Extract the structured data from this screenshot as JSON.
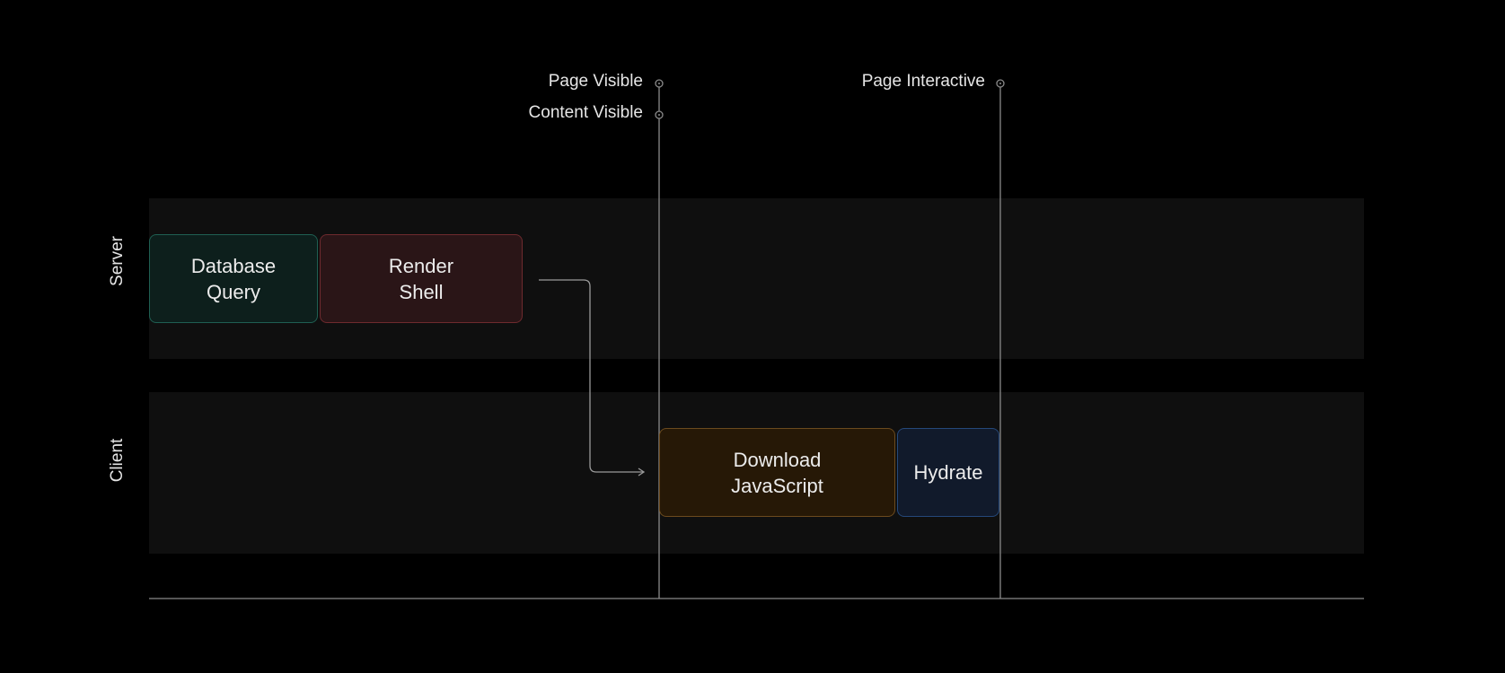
{
  "lanes": [
    {
      "label": "Server"
    },
    {
      "label": "Client"
    }
  ],
  "tasks": [
    {
      "label": "Database\nQuery",
      "lane": "Server",
      "color": "#1f5f52",
      "fill": "#0d1f1c"
    },
    {
      "label": "Render\nShell",
      "lane": "Server",
      "color": "#6e2a2e",
      "fill": "#2a1517"
    },
    {
      "label": "Download\nJavaScript",
      "lane": "Client",
      "color": "#6b4a1e",
      "fill": "#261806"
    },
    {
      "label": "Hydrate",
      "lane": "Client",
      "color": "#25487a",
      "fill": "#111a2b"
    }
  ],
  "milestones": [
    {
      "label": "Page Visible"
    },
    {
      "label": "Content Visible"
    },
    {
      "label": "Page Interactive"
    }
  ]
}
